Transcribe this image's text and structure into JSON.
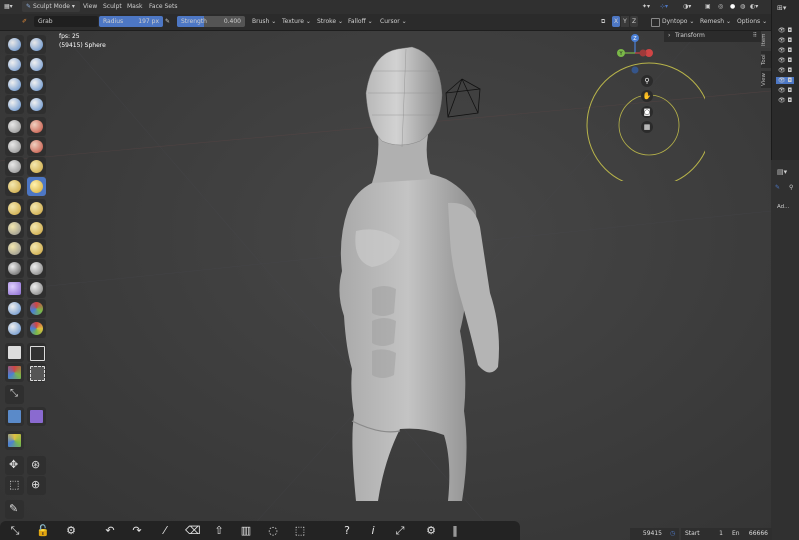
{
  "header": {
    "mode": "Sculpt Mode",
    "menus": [
      "View",
      "Sculpt",
      "Mask",
      "Face Sets"
    ]
  },
  "toolbar": {
    "brush_name": "Grab",
    "radius_label": "Radius",
    "radius_value": "197 px",
    "strength_label": "Strength",
    "strength_value": "0.400",
    "strength_fill": 0.4,
    "menus": [
      "Brush",
      "Texture",
      "Stroke",
      "Falloff",
      "Cursor"
    ],
    "axes": [
      "X",
      "Y",
      "Z"
    ],
    "right_menus": [
      "Dyntopo",
      "Remesh",
      "Options"
    ]
  },
  "viewport": {
    "fps": "fps: 25",
    "object_info": "(59415) Sphere"
  },
  "sidebar": {
    "transform_label": "Transform",
    "tabs": [
      "Item",
      "Tool",
      "View"
    ]
  },
  "right_panel": {
    "label": "Ad..."
  },
  "status_bar": {
    "count": "59415",
    "start_label": "Start",
    "start_value": "1",
    "end_label": "En",
    "end_value": "66666"
  },
  "colors": {
    "accent": "#4d77c4",
    "gizmo_circle": "#b8b44a",
    "axis_x": "#d04545",
    "axis_y": "#7ab848",
    "axis_z": "#4a7fd6"
  }
}
